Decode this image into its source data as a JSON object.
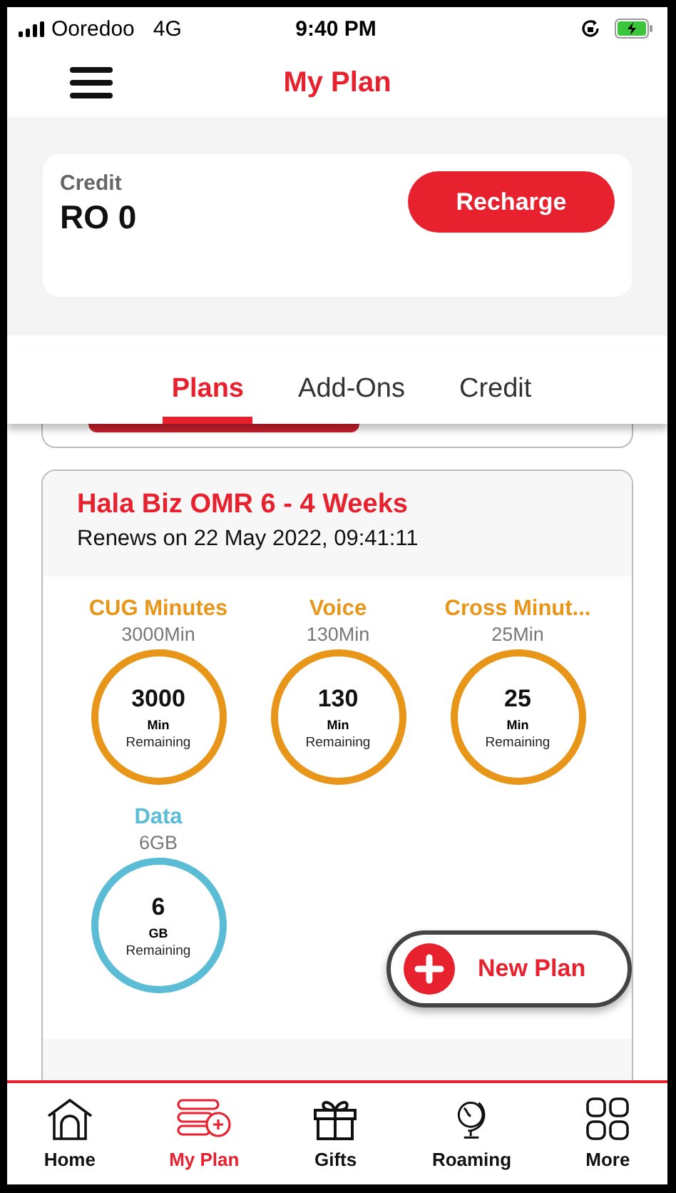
{
  "status_bar": {
    "carrier": "Ooredoo",
    "network": "4G",
    "time": "9:40 PM"
  },
  "header": {
    "title": "My Plan"
  },
  "credit": {
    "label": "Credit",
    "amount": "RO 0",
    "button": "Recharge"
  },
  "tabs": [
    {
      "label": "Plans",
      "selected": true
    },
    {
      "label": "Add-Ons",
      "selected": false
    },
    {
      "label": "Credit",
      "selected": false
    }
  ],
  "plan": {
    "title": "Hala Biz OMR 6 - 4 Weeks",
    "renews": "Renews on 22 May 2022, 09:41:11",
    "usage": [
      {
        "name": "CUG Minutes",
        "total": "3000Min",
        "value": "3000",
        "unit": "Min",
        "caption": "Remaining",
        "color": "#e8961a"
      },
      {
        "name": "Voice",
        "total": "130Min",
        "value": "130",
        "unit": "Min",
        "caption": "Remaining",
        "color": "#e8961a"
      },
      {
        "name": "Cross Minut...",
        "total": "25Min",
        "value": "25",
        "unit": "Min",
        "caption": "Remaining",
        "color": "#e8961a"
      },
      {
        "name": "Data",
        "total": "6GB",
        "value": "6",
        "unit": "GB",
        "caption": "Remaining",
        "color": "#5bbcd6"
      }
    ]
  },
  "new_plan_button": {
    "label": "New Plan"
  },
  "nav": [
    {
      "kind": "home",
      "label": "Home",
      "selected": false
    },
    {
      "kind": "plan",
      "label": "My Plan",
      "selected": true
    },
    {
      "kind": "gift",
      "label": "Gifts",
      "selected": false
    },
    {
      "kind": "globe",
      "label": "Roaming",
      "selected": false
    },
    {
      "kind": "grid",
      "label": "More",
      "selected": false
    }
  ]
}
